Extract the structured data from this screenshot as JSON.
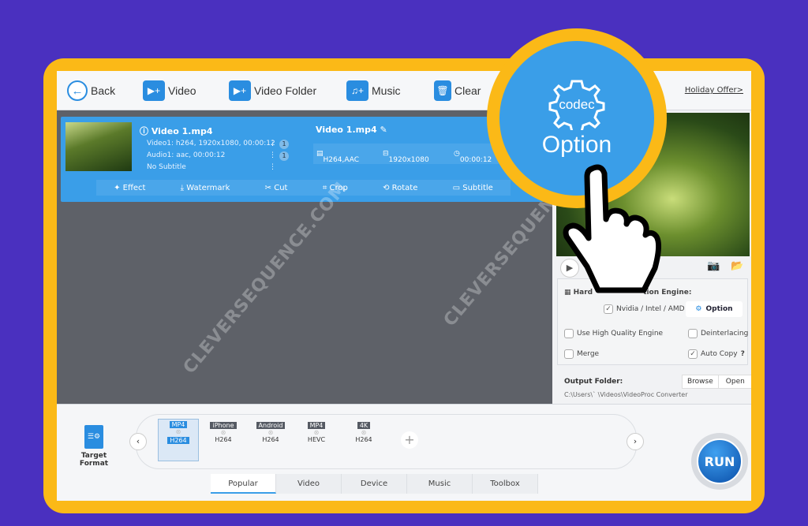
{
  "toolbar": {
    "back": "Back",
    "video": "Video",
    "video_folder": "Video Folder",
    "music": "Music",
    "clear": "Clear",
    "holiday": "Holiday Offer>"
  },
  "item": {
    "name": "Video 1.mp4",
    "video_track": "Video1: h264, 1920x1080, 00:00:12",
    "audio_track": "Audio1: aac, 00:00:12",
    "subtitle": "No Subtitle",
    "track_count_video": "1",
    "track_count_audio": "1",
    "output_name": "Video 1.mp4",
    "codec": "H264,AAC",
    "resolution": "1920x1080",
    "duration": "00:00:12",
    "edits": [
      "Effect",
      "Watermark",
      "Cut",
      "Crop",
      "Rotate",
      "Subtitle"
    ]
  },
  "options": {
    "hw_label": "Hardware Acceleration Engine:",
    "hw_visible_left": "Hard",
    "hw_visible_right": "tion Engine:",
    "nvidia": "Nvidia / Intel / AMD",
    "option_btn": "Option",
    "high_quality": "Use High Quality Engine",
    "deinterlacing": "Deinterlacing",
    "merge": "Merge",
    "auto_copy": "Auto Copy",
    "help": "?",
    "nvidia_checked": true,
    "high_quality_checked": false,
    "deinterlacing_checked": false,
    "merge_checked": false,
    "auto_copy_checked": true
  },
  "output": {
    "label": "Output Folder:",
    "browse": "Browse",
    "open": "Open",
    "path": "C:\\Users\\` \\Videos\\VideoProc Converter"
  },
  "bottom": {
    "target_format": "Target Format",
    "formats": [
      {
        "top": "MP4",
        "bottom": "H264",
        "selected": true
      },
      {
        "top": "iPhone",
        "bottom": "H264"
      },
      {
        "top": "Android",
        "bottom": "H264"
      },
      {
        "top": "MP4",
        "bottom": "HEVC"
      },
      {
        "top": "4K",
        "bottom": "H264"
      }
    ],
    "tabs": [
      "Popular",
      "Video",
      "Device",
      "Music",
      "Toolbox"
    ],
    "active_tab": "Popular",
    "run": "RUN",
    "add": "+"
  },
  "callout": {
    "icon_text": "codec",
    "label": "Option"
  },
  "watermark": "CLEVERSEQUENCE.COM",
  "colors": {
    "background": "#4a30bf",
    "frame": "#fbb917",
    "accent": "#3a9ee8"
  }
}
